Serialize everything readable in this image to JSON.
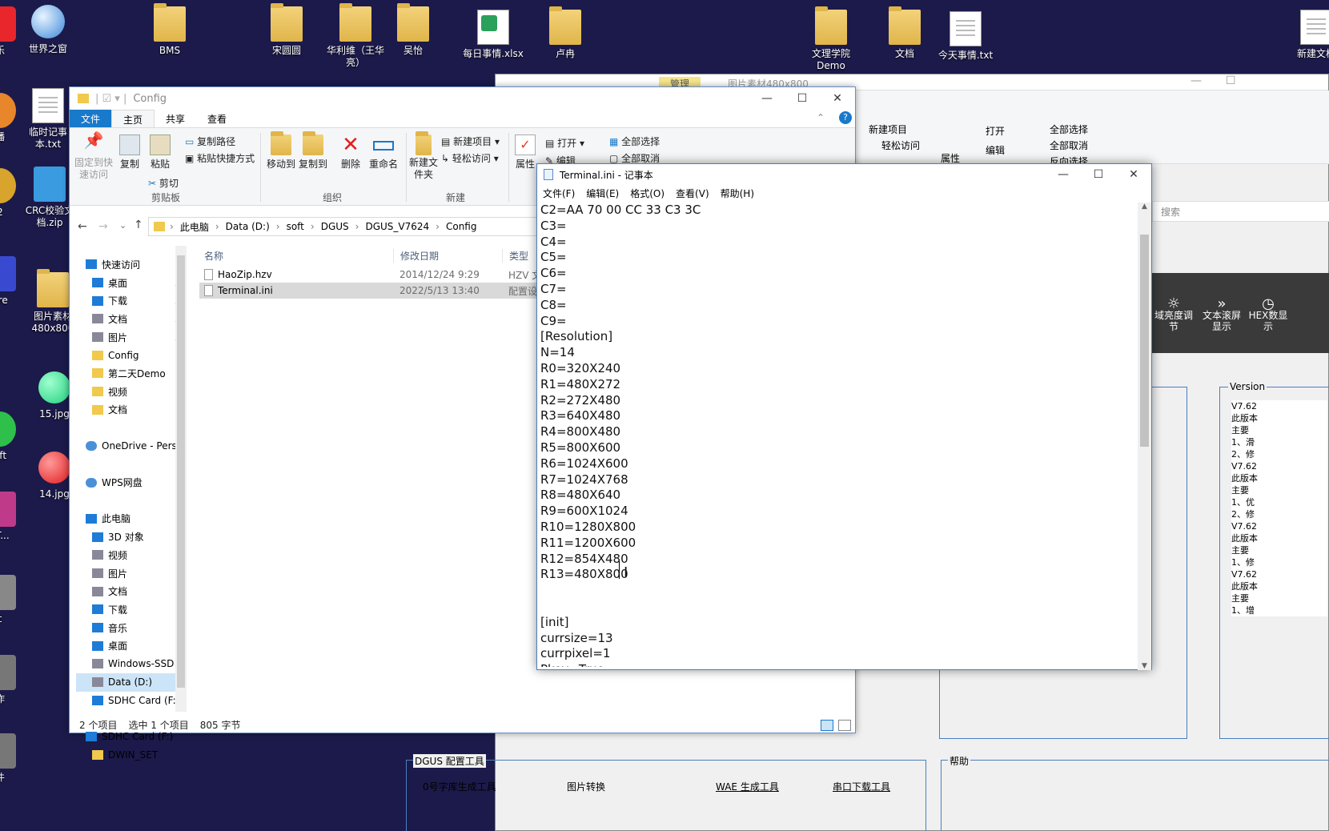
{
  "desktop": {
    "icons": [
      {
        "label": "乐"
      },
      {
        "label": "世界之窗"
      },
      {
        "label": "BMS"
      },
      {
        "label": "宋圆圆"
      },
      {
        "label": "华利维（王华亮）"
      },
      {
        "label": "吴怡"
      },
      {
        "label": "每日事情.xlsx"
      },
      {
        "label": "卢冉"
      },
      {
        "label": "文理学院Demo"
      },
      {
        "label": "文档"
      },
      {
        "label": "今天事情.txt"
      },
      {
        "label": "新建文档"
      },
      {
        "label": "播"
      },
      {
        "label": "临时记事本.txt"
      },
      {
        "label": "2"
      },
      {
        "label": "CRC校验文档.zip"
      },
      {
        "label": "are"
      },
      {
        "label": "图片素材480x800"
      },
      {
        "label": "15.jpg"
      },
      {
        "label": "oft"
      },
      {
        "label": "14.jpg"
      },
      {
        "label": "_T..."
      },
      {
        "label": "t"
      },
      {
        "label": "作"
      },
      {
        "label": "件"
      }
    ]
  },
  "bg_app": {
    "title": "图片素材480x800",
    "manage_tab": "管理",
    "ribbon": {
      "new_item": "新建项目",
      "easy_access": "轻松访问",
      "open": "打开",
      "edit": "编辑",
      "properties": "属性",
      "select_all": "全部选择",
      "select_none": "全部取消",
      "invert": "反向选择"
    },
    "search": "搜索",
    "tools": [
      {
        "label": "域亮度调节"
      },
      {
        "label": "文本滚屏显示"
      },
      {
        "label": "HEX数显示"
      }
    ],
    "version_label": "Version",
    "version_lines": [
      "V7.62",
      "此版本",
      "主要",
      "1、滑",
      "2、修",
      "V7.62",
      "此版本",
      "主要",
      "1、优",
      "2、修",
      "V7.62",
      "此版本",
      "主要",
      "1、修",
      "V7.62",
      "此版本",
      "主要",
      "1、增"
    ],
    "dgus_group": "DGUS 配置工具",
    "help_group": "帮助",
    "bottom_tools": [
      "0号字库生成工具",
      "图片转换",
      "WAE 生成工具",
      "串口下载工具"
    ]
  },
  "explorer": {
    "title": "Config",
    "tabs": {
      "file": "文件",
      "home": "主页",
      "share": "共享",
      "view": "查看"
    },
    "ribbon": {
      "pin": "固定到快速访问",
      "copy": "复制",
      "paste": "粘贴",
      "copy_path": "复制路径",
      "paste_shortcut": "粘贴快捷方式",
      "cut": "剪切",
      "clipboard": "剪贴板",
      "move_to": "移动到",
      "copy_to": "复制到",
      "delete": "删除",
      "rename": "重命名",
      "organize": "组织",
      "new_folder": "新建文件夹",
      "new_item": "新建项目",
      "easy_access": "轻松访问",
      "new_group": "新建",
      "properties": "属性",
      "open": "打开",
      "edit": "编辑",
      "select_all": "全部选择",
      "select_none": "全部取消"
    },
    "breadcrumb": [
      "此电脑",
      "Data (D:)",
      "soft",
      "DGUS",
      "DGUS_V7624",
      "Config"
    ],
    "nav": [
      {
        "label": "快速访问",
        "kind": "blue"
      },
      {
        "label": "桌面",
        "kind": "blue"
      },
      {
        "label": "下载",
        "kind": "blue"
      },
      {
        "label": "文档",
        "kind": "gray"
      },
      {
        "label": "图片",
        "kind": "gray"
      },
      {
        "label": "Config",
        "kind": "fold"
      },
      {
        "label": "第二天Demo",
        "kind": "fold"
      },
      {
        "label": "视频",
        "kind": "fold"
      },
      {
        "label": "文档",
        "kind": "fold"
      },
      {
        "label": "",
        "kind": "none"
      },
      {
        "label": "OneDrive - Perso",
        "kind": "cloud"
      },
      {
        "label": "",
        "kind": "none"
      },
      {
        "label": "WPS网盘",
        "kind": "cloud"
      },
      {
        "label": "",
        "kind": "none"
      },
      {
        "label": "此电脑",
        "kind": "blue"
      },
      {
        "label": "3D 对象",
        "kind": "blue"
      },
      {
        "label": "视频",
        "kind": "gray"
      },
      {
        "label": "图片",
        "kind": "gray"
      },
      {
        "label": "文档",
        "kind": "gray"
      },
      {
        "label": "下载",
        "kind": "blue"
      },
      {
        "label": "音乐",
        "kind": "blue"
      },
      {
        "label": "桌面",
        "kind": "blue"
      },
      {
        "label": "Windows-SSD",
        "kind": "gray"
      },
      {
        "label": "Data (D:)",
        "kind": "gray"
      },
      {
        "label": "SDHC Card (F:)",
        "kind": "blue"
      },
      {
        "label": "",
        "kind": "none"
      },
      {
        "label": "SDHC Card (F:)",
        "kind": "blue"
      },
      {
        "label": "DWIN_SET",
        "kind": "fold"
      }
    ],
    "columns": {
      "name": "名称",
      "modified": "修改日期",
      "type": "类型"
    },
    "files": [
      {
        "name": "HaoZip.hzv",
        "modified": "2014/12/24 9:29",
        "type": "HZV 文"
      },
      {
        "name": "Terminal.ini",
        "modified": "2022/5/13 13:40",
        "type": "配置设"
      }
    ],
    "status": {
      "count": "2 个项目",
      "selected": "选中 1 个项目",
      "size": "805 字节"
    }
  },
  "notepad": {
    "title": "Terminal.ini - 记事本",
    "menu": [
      "文件(F)",
      "编辑(E)",
      "格式(O)",
      "查看(V)",
      "帮助(H)"
    ],
    "lines": [
      "C2=AA 70 00 CC 33 C3 3C",
      "C3=",
      "C4=",
      "C5=",
      "C6=",
      "C7=",
      "C8=",
      "C9=",
      "[Resolution]",
      "N=14",
      "R0=320X240",
      "R1=480X272",
      "R2=272X480",
      "R3=640X480",
      "R4=800X480",
      "R5=800X600",
      "R6=1024X600",
      "R7=1024X768",
      "R8=480X640",
      "R9=600X1024",
      "R10=1280X800",
      "R11=1200X600",
      "R12=854X480",
      "R13=480X800",
      "",
      "",
      "[init]",
      "currsize=13",
      "currpixel=1",
      "Pkey=True"
    ]
  }
}
